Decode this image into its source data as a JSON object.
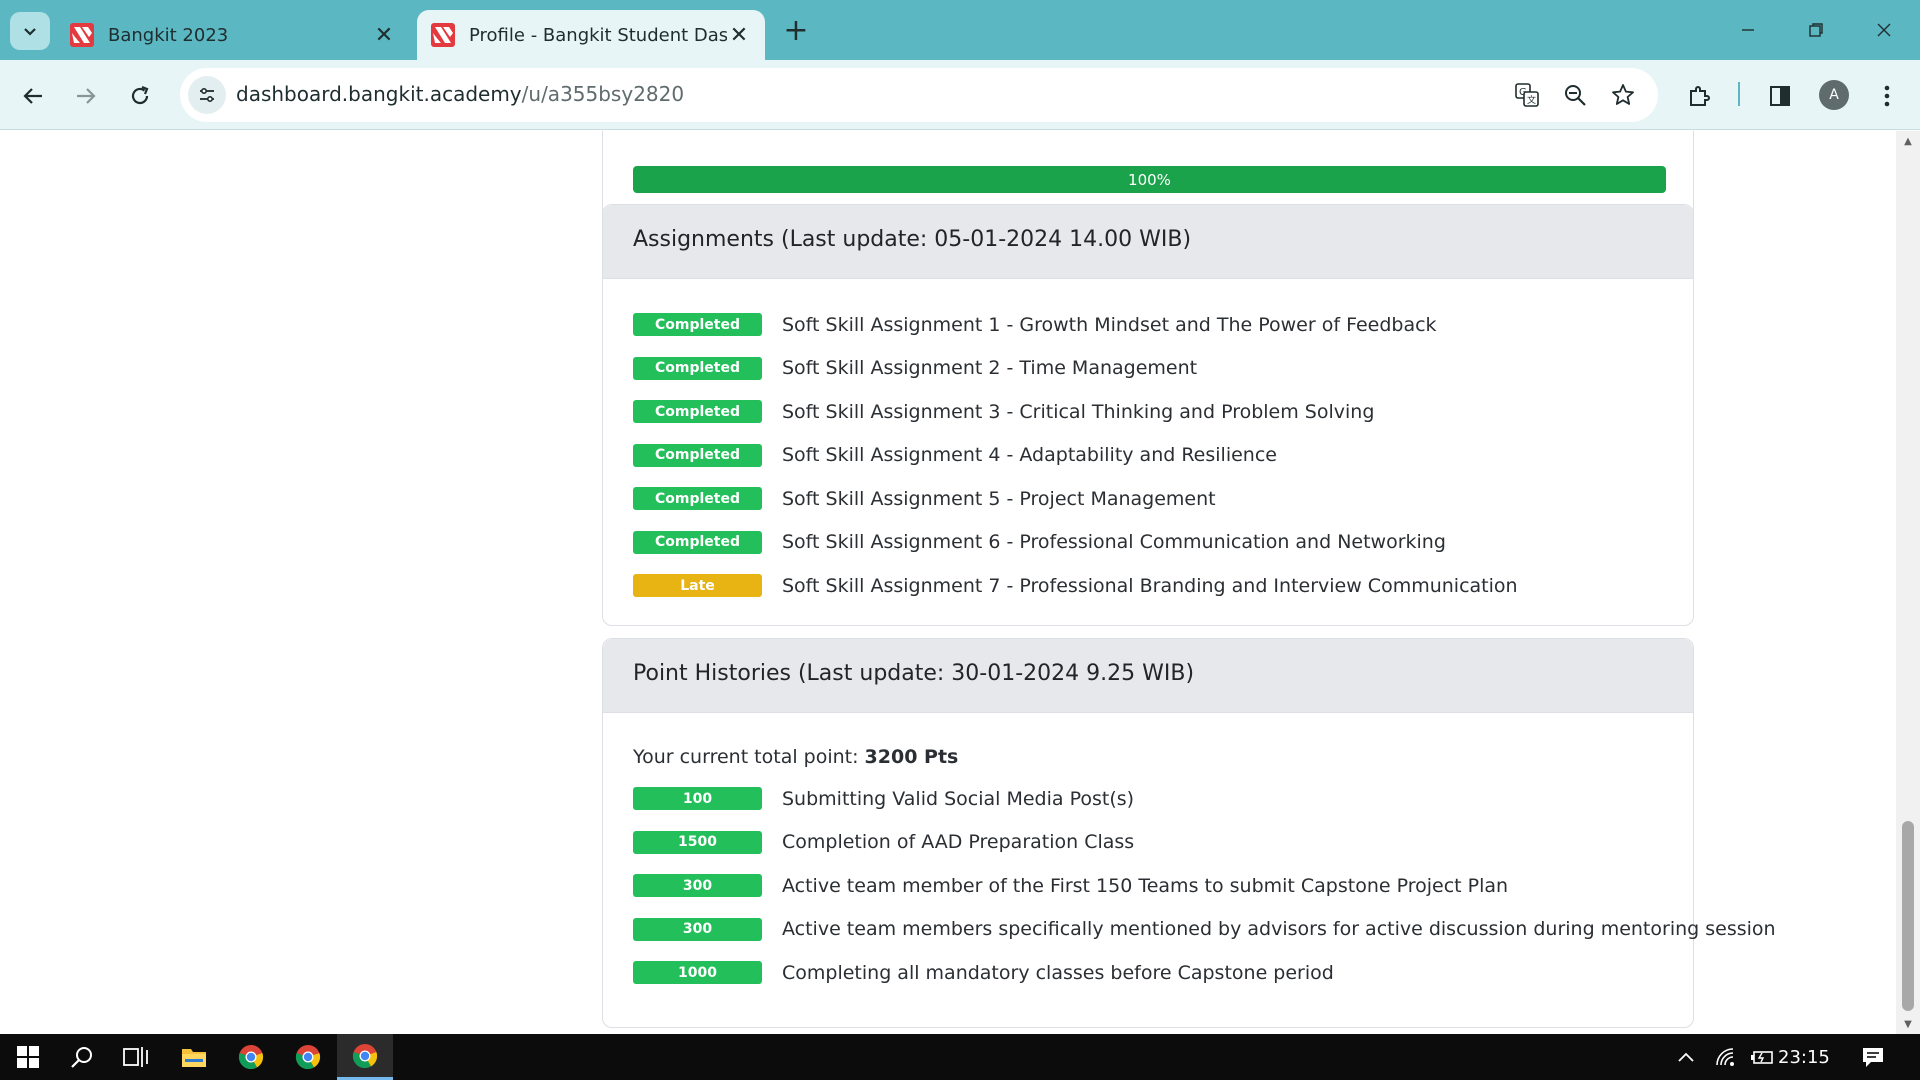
{
  "browser": {
    "tabs": [
      {
        "title": "Bangkit 2023",
        "active": false
      },
      {
        "title": "Profile - Bangkit Student Dashb",
        "active": true
      }
    ],
    "url_host": "dashboard.bangkit.academy",
    "url_path": "/u/a355bsy2820",
    "profile_initial": "A",
    "accent_color": "#5bb8c2"
  },
  "page": {
    "progress": {
      "label": "100%",
      "value": 100
    },
    "assignments": {
      "title": "Assignments (Last update: 05-01-2024 14.00 WIB)",
      "items": [
        {
          "status": "Completed",
          "name": "Soft Skill Assignment 1 - Growth Mindset and The Power of Feedback"
        },
        {
          "status": "Completed",
          "name": "Soft Skill Assignment 2 - Time Management"
        },
        {
          "status": "Completed",
          "name": "Soft Skill Assignment 3 - Critical Thinking and Problem Solving"
        },
        {
          "status": "Completed",
          "name": "Soft Skill Assignment 4 - Adaptability and Resilience"
        },
        {
          "status": "Completed",
          "name": "Soft Skill Assignment 5 - Project Management"
        },
        {
          "status": "Completed",
          "name": "Soft Skill Assignment 6 - Professional Communication and Networking"
        },
        {
          "status": "Late",
          "name": "Soft Skill Assignment 7 - Professional Branding and Interview Communication"
        }
      ]
    },
    "points": {
      "title": "Point Histories (Last update: 30-01-2024 9.25 WIB)",
      "total_label": "Your current total point:",
      "total_value": "3200 Pts",
      "items": [
        {
          "points": "100",
          "desc": "Submitting Valid Social Media Post(s)"
        },
        {
          "points": "1500",
          "desc": "Completion of AAD Preparation Class"
        },
        {
          "points": "300",
          "desc": "Active team member of the First 150 Teams to submit Capstone Project Plan"
        },
        {
          "points": "300",
          "desc": "Active team members specifically mentioned by advisors for active discussion during mentoring session"
        },
        {
          "points": "1000",
          "desc": "Completing all mandatory classes before Capstone period"
        }
      ]
    },
    "colors": {
      "completed": "#22bf5a",
      "late": "#e7b414",
      "progress": "#1aa34a"
    }
  },
  "taskbar": {
    "clock": "23:15",
    "apps": [
      "start-icon",
      "search-icon",
      "task-view-icon",
      "file-explorer-icon",
      "chrome-icon",
      "chrome-icon",
      "chrome-icon"
    ]
  }
}
